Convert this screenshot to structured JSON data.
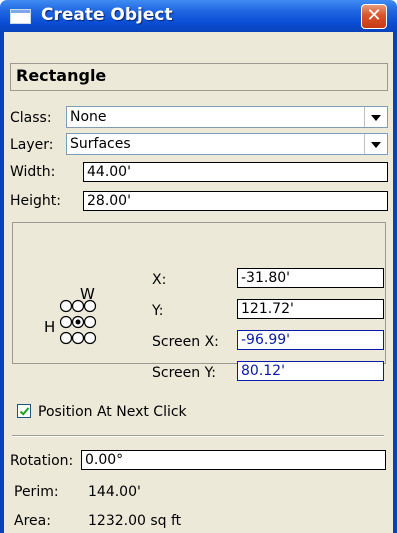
{
  "window": {
    "title": "Create Object",
    "close_glyph": "✕"
  },
  "shape_name": "Rectangle",
  "class": {
    "label": "Class:",
    "value": "None"
  },
  "layer": {
    "label": "Layer:",
    "value": "Surfaces"
  },
  "width": {
    "label": "Width:",
    "value": "44.00'"
  },
  "height": {
    "label": "Height:",
    "value": "28.00'"
  },
  "position": {
    "w_label": "W",
    "h_label": "H",
    "x": {
      "label": "X:",
      "value": "-31.80'"
    },
    "y": {
      "label": "Y:",
      "value": "121.72'"
    },
    "screen_x": {
      "label": "Screen X:",
      "value": "-96.99'"
    },
    "screen_y": {
      "label": "Screen Y:",
      "value": "80.12'"
    }
  },
  "position_at_next_click": {
    "label": "Position At Next Click",
    "checked": true
  },
  "rotation": {
    "label": "Rotation:",
    "value": "0.00°"
  },
  "perim": {
    "label": "Perim:",
    "value": "144.00'"
  },
  "area": {
    "label": "Area:",
    "value": "1232.00 sq ft"
  }
}
